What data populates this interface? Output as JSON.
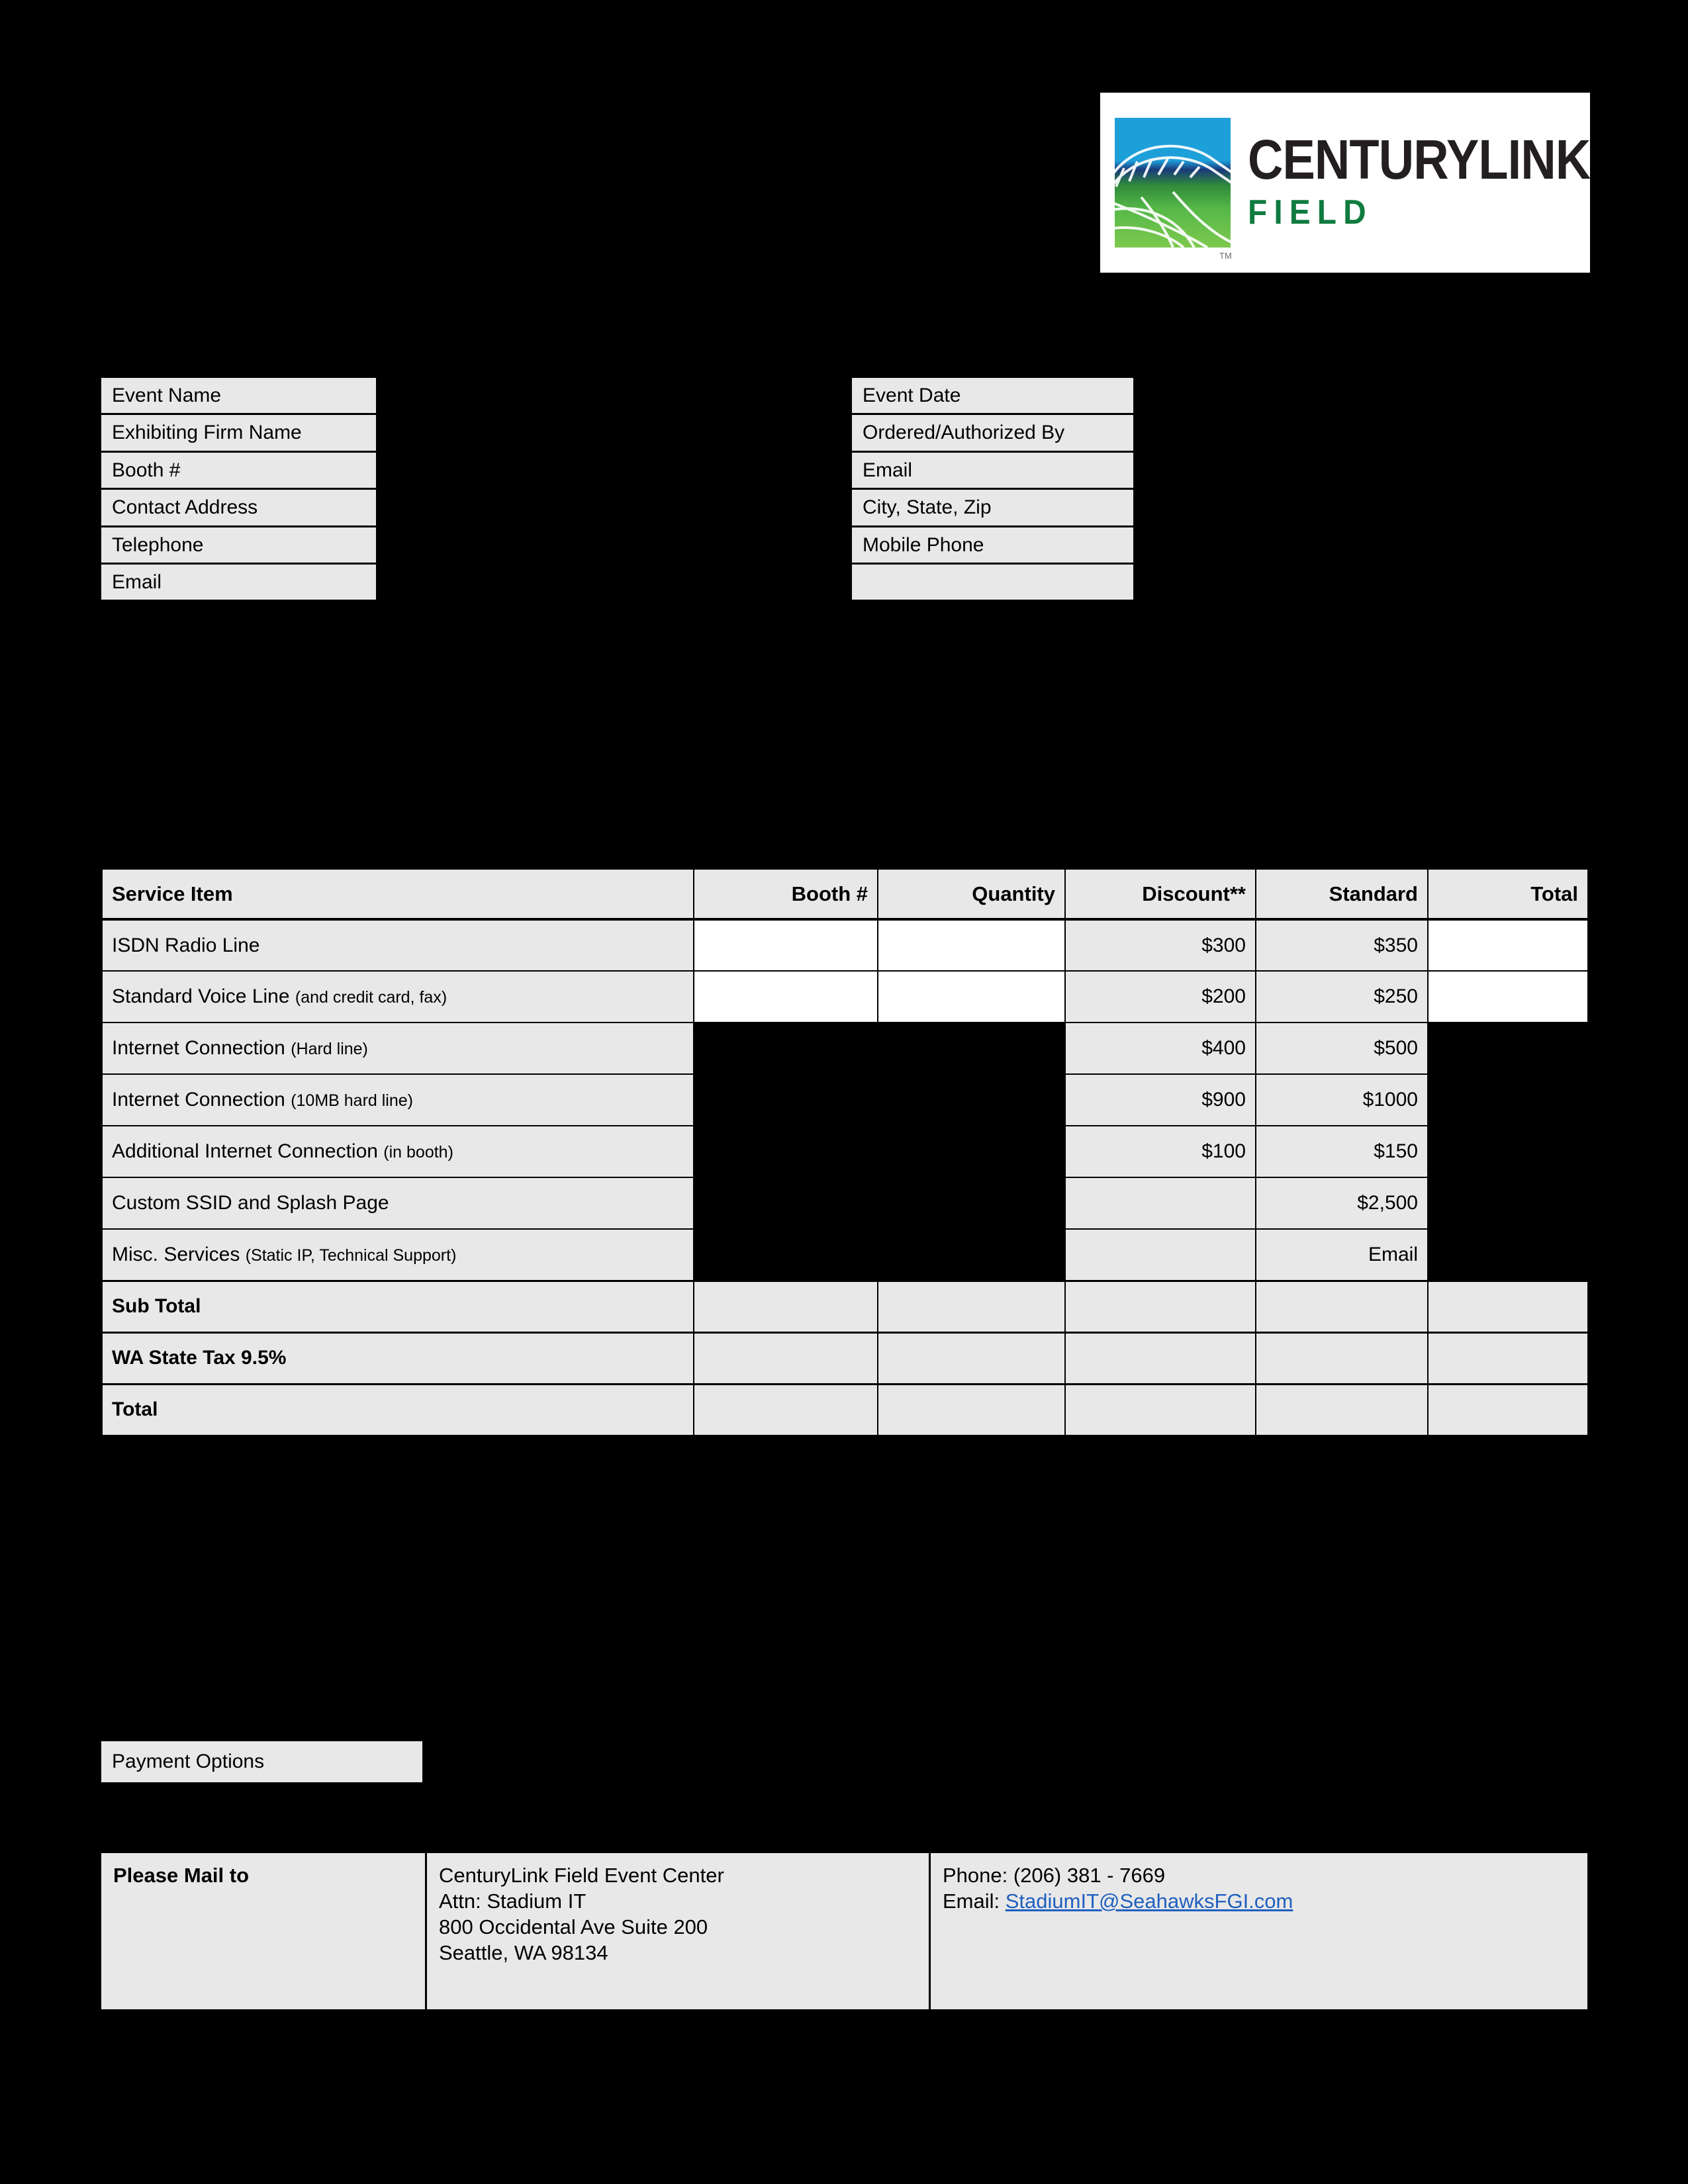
{
  "logo": {
    "name_part1": "C",
    "name_part1_rest": "ENTURY",
    "name_part2": "L",
    "name_part2_rest": "INK",
    "century_text": "CenturyLink",
    "field_text": "FIELD",
    "tm": "TM"
  },
  "form": {
    "left_fields": [
      "Event Name",
      "Exhibiting Firm Name",
      "Booth #",
      "Contact Address",
      "Telephone",
      "Email"
    ],
    "right_fields": [
      "Event Date",
      "Ordered/Authorized By",
      "Email",
      "City, State, Zip",
      "Mobile Phone",
      ""
    ]
  },
  "service_table": {
    "headers": [
      "Service Item",
      "Booth #",
      "Quantity",
      "Discount**",
      "Standard",
      "Total"
    ],
    "rows": [
      {
        "name": "ISDN Radio Line",
        "qualifier": "",
        "booth": "",
        "quantity": "",
        "discount": "$300",
        "standard": "$350",
        "total": "",
        "fill": "white"
      },
      {
        "name": "Standard Voice Line",
        "qualifier": "(and credit card, fax)",
        "booth": "",
        "quantity": "",
        "discount": "$200",
        "standard": "$250",
        "total": "",
        "fill": "white"
      },
      {
        "name": "Internet Connection",
        "qualifier": "(Hard line)",
        "booth": "",
        "quantity": "",
        "discount": "$400",
        "standard": "$500",
        "total": "",
        "fill": "black"
      },
      {
        "name": "Internet Connection",
        "qualifier": "(10MB hard line)",
        "booth": "",
        "quantity": "",
        "discount": "$900",
        "standard": "$1000",
        "total": "",
        "fill": "black"
      },
      {
        "name": "Additional Internet Connection",
        "qualifier": "(in booth)",
        "booth": "",
        "quantity": "",
        "discount": "$100",
        "standard": "$150",
        "total": "",
        "fill": "black"
      },
      {
        "name": "Custom SSID and Splash Page",
        "qualifier": "",
        "booth": "",
        "quantity": "",
        "discount": "",
        "standard": "$2,500",
        "total": "",
        "fill": "black"
      },
      {
        "name": "Misc. Services",
        "qualifier": "(Static IP, Technical Support)",
        "booth": "",
        "quantity": "",
        "discount": "",
        "standard": "Email",
        "total": "",
        "fill": "black"
      }
    ],
    "summary_rows": [
      {
        "label": "Sub Total",
        "booth": "",
        "quantity": "",
        "discount": "",
        "standard": "",
        "total": ""
      },
      {
        "label": "WA State Tax 9.5%",
        "booth": "",
        "quantity": "",
        "discount": "",
        "standard": "",
        "total": ""
      },
      {
        "label": "Total",
        "booth": "",
        "quantity": "",
        "discount": "",
        "standard": "",
        "total": ""
      }
    ]
  },
  "payment": {
    "label": "Payment Options"
  },
  "mail": {
    "label": "Please Mail to",
    "address_lines": [
      "CenturyLink Field Event Center",
      "Attn: Stadium IT",
      "800 Occidental Ave Suite 200",
      "Seattle, WA 98134"
    ],
    "phone": "Phone: (206) 381 - 7669",
    "email_prefix": "Email: ",
    "email_link": "StadiumIT@SeahawksFGI.com"
  },
  "colors": {
    "page_background": "#000000",
    "cell_fill": "#e8e8e8",
    "blank_input": "#ffffff",
    "link": "#1f5fbf",
    "logo_green": "#0f7b3f",
    "logo_blue": "#1d9fd9"
  }
}
